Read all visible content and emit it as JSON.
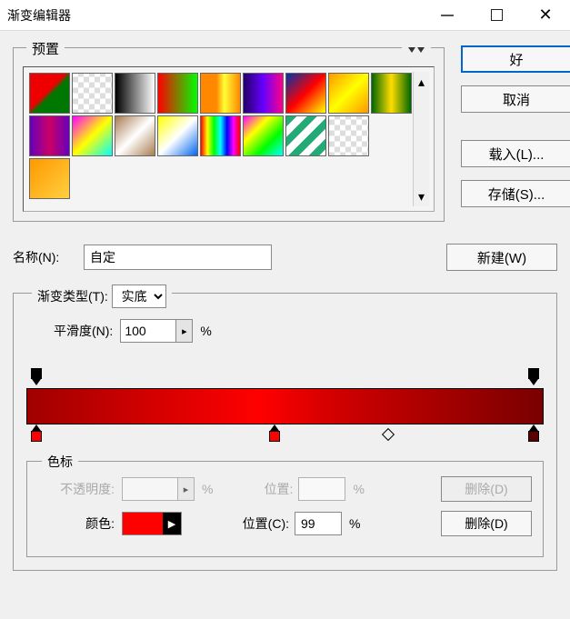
{
  "window": {
    "title": "渐变编辑器"
  },
  "preset": {
    "label": "预置"
  },
  "buttons": {
    "ok": "好",
    "cancel": "取消",
    "load": "载入(L)...",
    "save": "存储(S)...",
    "new": "新建(W)"
  },
  "name": {
    "label": "名称(N):",
    "value": "自定"
  },
  "gradient": {
    "type_label": "渐变类型(T):",
    "type_value": "实底",
    "smooth_label": "平滑度(N):",
    "smooth_value": "100",
    "pct": "%"
  },
  "stops": {
    "legend": "色标",
    "opacity_label": "不透明度:",
    "pos_label": "位置:",
    "pct": "%",
    "delete1": "删除(D)",
    "color_label": "颜色:",
    "pos_c_label": "位置(C):",
    "pos_c_value": "99",
    "delete2": "删除(D)"
  }
}
